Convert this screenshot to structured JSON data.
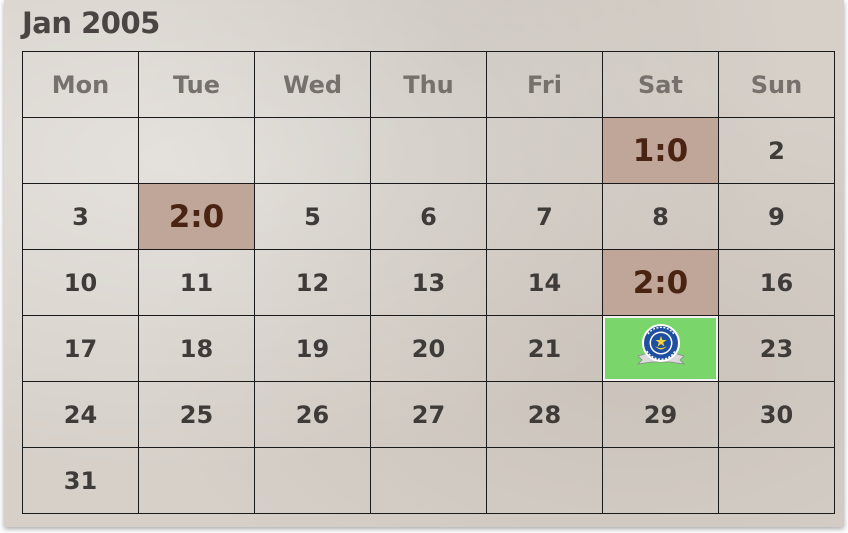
{
  "calendar": {
    "title": "Jan 2005",
    "weekdays": [
      "Mon",
      "Tue",
      "Wed",
      "Thu",
      "Fri",
      "Sat",
      "Sun"
    ],
    "weeks": [
      [
        "",
        "",
        "",
        "",
        "",
        "1:0",
        "2"
      ],
      [
        "3",
        "2:0",
        "5",
        "6",
        "7",
        "8",
        "9"
      ],
      [
        "10",
        "11",
        "12",
        "13",
        "14",
        "2:0",
        "16"
      ],
      [
        "17",
        "18",
        "19",
        "20",
        "21",
        "",
        "23"
      ],
      [
        "24",
        "25",
        "26",
        "27",
        "28",
        "29",
        "30"
      ],
      [
        "31",
        "",
        "",
        "",
        "",
        "",
        ""
      ]
    ],
    "score_color": "#c0a699",
    "highlight_color": "#7ad56a",
    "highlight_icon": "portsmouth-fc-crest-icon"
  }
}
